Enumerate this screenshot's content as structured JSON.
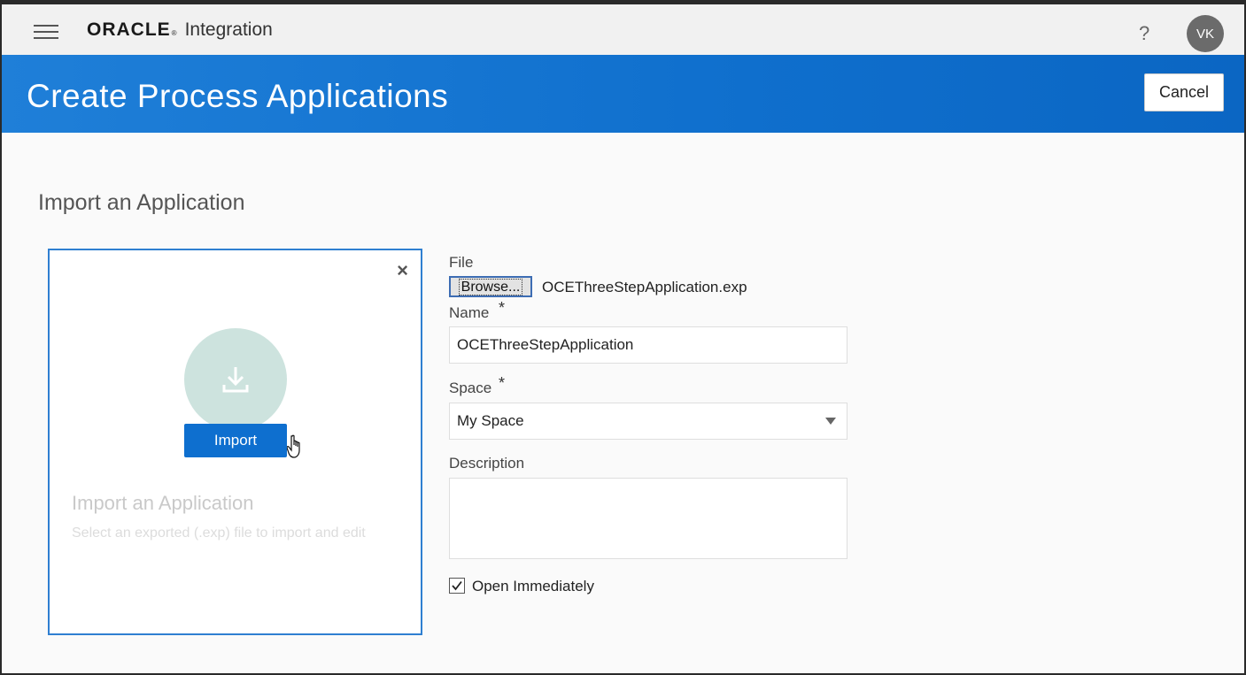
{
  "topbar": {
    "brand": "ORACLE",
    "brand_mark": "®",
    "product": "Integration",
    "help": "?",
    "avatar_initials": "VK"
  },
  "banner": {
    "title": "Create Process Applications",
    "cancel_label": "Cancel"
  },
  "section_title": "Import an Application",
  "card": {
    "close": "×",
    "import_label": "Import",
    "heading": "Import an Application",
    "description": "Select an exported (.exp) file to import and edit"
  },
  "form": {
    "file_label": "File",
    "browse_label": "Browse...",
    "file_name": "OCEThreeStepApplication.exp",
    "name_label": "Name",
    "name_value": "OCEThreeStepApplication",
    "space_label": "Space",
    "space_value": "My Space",
    "description_label": "Description",
    "description_value": "",
    "required_mark": "*",
    "open_immediately_label": "Open Immediately",
    "open_immediately_checked": true
  },
  "colors": {
    "banner_blue": "#0f6fcd",
    "import_button": "#0e6fcf",
    "card_border": "#2f7fd1"
  }
}
